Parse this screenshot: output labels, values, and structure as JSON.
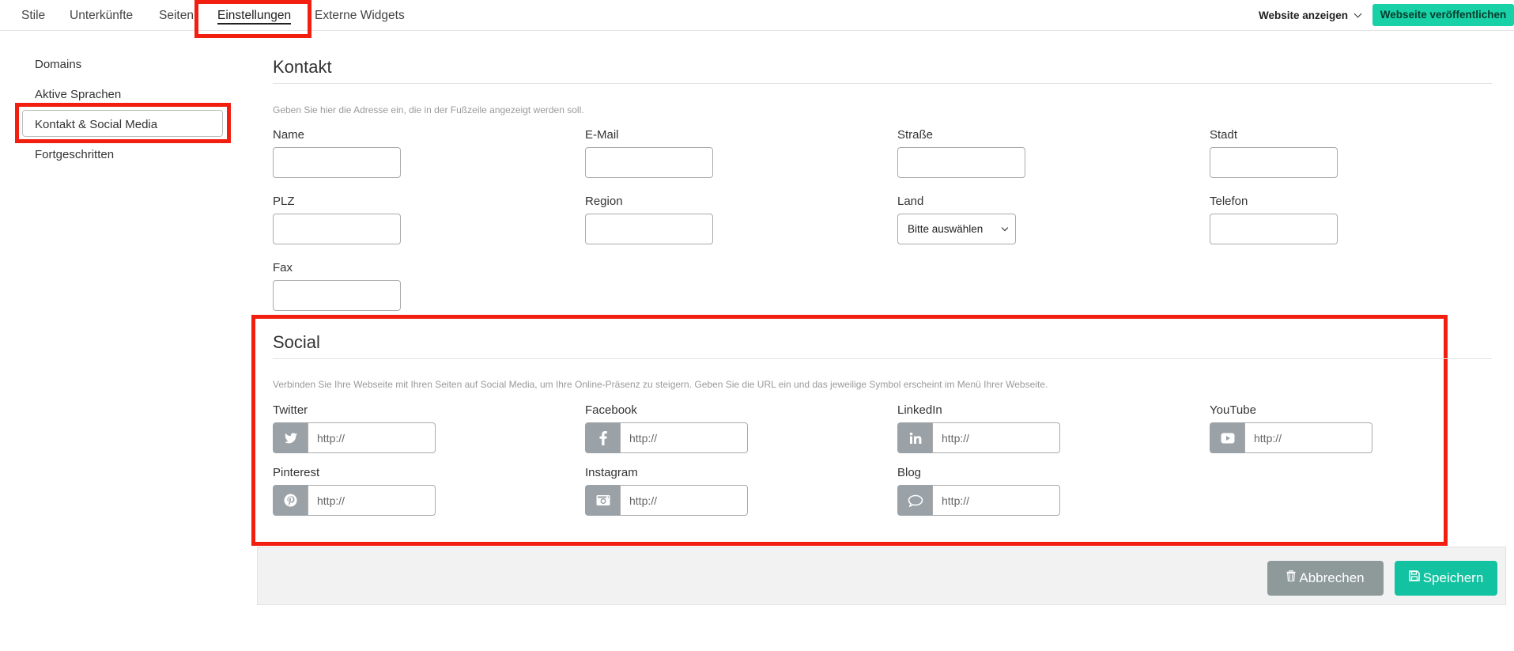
{
  "nav": {
    "tabs": [
      {
        "label": "Stile"
      },
      {
        "label": "Unterkünfte"
      },
      {
        "label": "Seiten"
      },
      {
        "label": "Einstellungen"
      },
      {
        "label": "Externe Widgets"
      }
    ],
    "active_tab": "Einstellungen",
    "website_show_label": "Website anzeigen",
    "publish_label": "Webseite veröffentlichen"
  },
  "sidebar": {
    "items": [
      {
        "label": "Domains"
      },
      {
        "label": "Aktive Sprachen"
      },
      {
        "label": "Kontakt & Social Media"
      },
      {
        "label": "Fortgeschritten"
      }
    ],
    "active_item": "Kontakt & Social Media"
  },
  "contact": {
    "title": "Kontakt",
    "hint": "Geben Sie hier die Adresse ein, die in der Fußzeile angezeigt werden soll.",
    "fields": {
      "name": {
        "label": "Name",
        "value": ""
      },
      "email": {
        "label": "E-Mail",
        "value": ""
      },
      "street": {
        "label": "Straße",
        "value": ""
      },
      "city": {
        "label": "Stadt",
        "value": ""
      },
      "zip": {
        "label": "PLZ",
        "value": ""
      },
      "region": {
        "label": "Region",
        "value": ""
      },
      "country": {
        "label": "Land",
        "selected": "Bitte auswählen"
      },
      "phone": {
        "label": "Telefon",
        "value": ""
      },
      "fax": {
        "label": "Fax",
        "value": ""
      }
    }
  },
  "social": {
    "title": "Social",
    "hint": "Verbinden Sie Ihre Webseite mit Ihren Seiten auf Social Media, um Ihre Online-Präsenz zu steigern. Geben Sie die URL ein und das jeweilige Symbol erscheint im Menü Ihrer Webseite.",
    "networks": {
      "twitter": {
        "label": "Twitter",
        "placeholder": "http://",
        "icon": "twitter-icon"
      },
      "facebook": {
        "label": "Facebook",
        "placeholder": "http://",
        "icon": "facebook-icon"
      },
      "linkedin": {
        "label": "LinkedIn",
        "placeholder": "http://",
        "icon": "linkedin-icon"
      },
      "youtube": {
        "label": "YouTube",
        "placeholder": "http://",
        "icon": "youtube-icon"
      },
      "pinterest": {
        "label": "Pinterest",
        "placeholder": "http://",
        "icon": "pinterest-icon"
      },
      "instagram": {
        "label": "Instagram",
        "placeholder": "http://",
        "icon": "instagram-icon"
      },
      "blog": {
        "label": "Blog",
        "placeholder": "http://",
        "icon": "speech-bubble-icon"
      }
    }
  },
  "actions": {
    "cancel_label": "Abbrechen",
    "cancel_icon": "trash-icon",
    "save_label": "Speichern",
    "save_icon": "floppy-disk-icon"
  },
  "colors": {
    "accent": "#19d1a6",
    "save": "#13c2a0",
    "cancel": "#8e9a99",
    "social_icon_bg": "#9ba2a7",
    "highlight_red": "#f21e10"
  }
}
